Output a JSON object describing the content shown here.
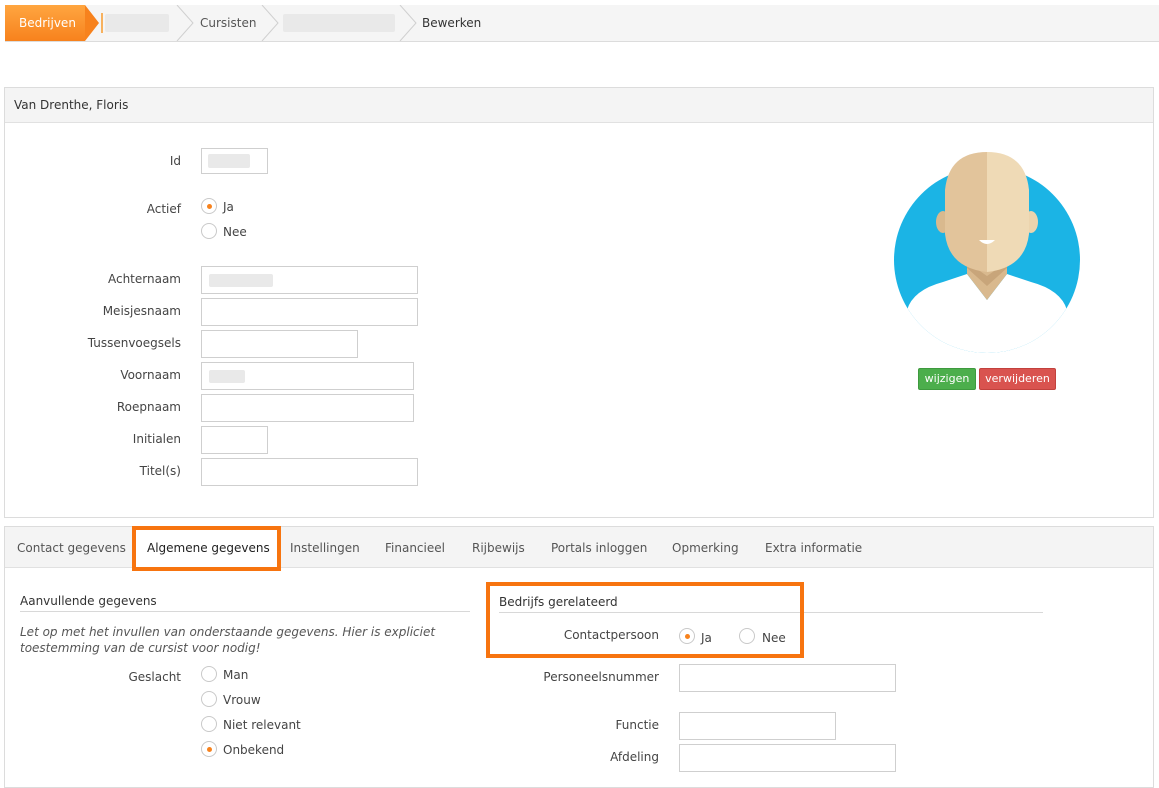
{
  "breadcrumb": {
    "home": "Bedrijven",
    "cursisten": "Cursisten",
    "current": "Bewerken"
  },
  "person": {
    "header_name": "Van Drenthe, Floris",
    "fields": {
      "id_label": "Id",
      "actief_label": "Actief",
      "actief_ja": "Ja",
      "actief_nee": "Nee",
      "achternaam_label": "Achternaam",
      "meisjesnaam_label": "Meisjesnaam",
      "tussenvoegsels_label": "Tussenvoegsels",
      "voornaam_label": "Voornaam",
      "roepnaam_label": "Roepnaam",
      "initialen_label": "Initialen",
      "titels_label": "Titel(s)"
    },
    "actief_selected": "Ja",
    "photo": {
      "edit_button": "wijzigen",
      "delete_button": "verwijderen",
      "avatar_bg": "#1bb4e5"
    }
  },
  "tabs": [
    {
      "label": "Contact gegevens",
      "active": false
    },
    {
      "label": "Algemene gegevens",
      "active": true
    },
    {
      "label": "Instellingen",
      "active": false
    },
    {
      "label": "Financieel",
      "active": false
    },
    {
      "label": "Rijbewijs",
      "active": false
    },
    {
      "label": "Portals inloggen",
      "active": false
    },
    {
      "label": "Opmerking",
      "active": false
    },
    {
      "label": "Extra informatie",
      "active": false
    }
  ],
  "aanvullend": {
    "title": "Aanvullende gegevens",
    "note": "Let op met het invullen van onderstaande gegevens. Hier is expliciet toestemming van de cursist voor nodig!",
    "geslacht_label": "Geslacht",
    "geslacht_options": [
      "Man",
      "Vrouw",
      "Niet relevant",
      "Onbekend"
    ],
    "geslacht_selected": "Onbekend"
  },
  "bedrijf": {
    "title": "Bedrijfs gerelateerd",
    "contactpersoon_label": "Contactpersoon",
    "contactpersoon_ja": "Ja",
    "contactpersoon_nee": "Nee",
    "contactpersoon_selected": "Ja",
    "personeelsnummer_label": "Personeelsnummer",
    "functie_label": "Functie",
    "afdeling_label": "Afdeling"
  },
  "colors": {
    "accent": "#f7821d",
    "highlight": "#f7740f",
    "edit_green": "#4cae4c",
    "delete_red": "#d9534f"
  }
}
